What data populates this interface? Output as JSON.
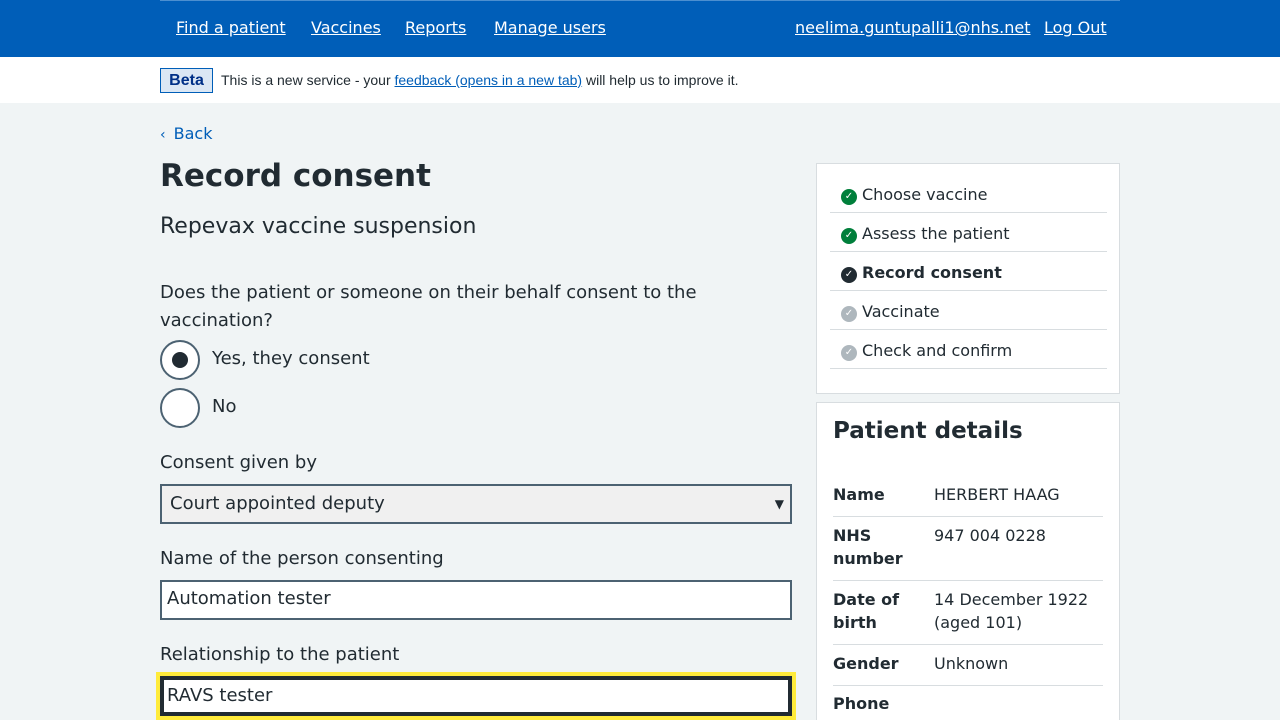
{
  "header": {
    "nav": [
      "Find a patient",
      "Vaccines",
      "Reports",
      "Manage users"
    ],
    "user_email": "neelima.guntupalli1@nhs.net",
    "logout": "Log Out"
  },
  "beta": {
    "tag": "Beta",
    "text_before": "This is a new service - your ",
    "link": "feedback (opens in a new tab)",
    "text_after": " will help us to improve it."
  },
  "back": "Back",
  "title": "Record consent",
  "vaccine": "Repevax vaccine suspension",
  "form": {
    "question": "Does the patient or someone on their behalf consent to the vaccination?",
    "options": [
      {
        "label": "Yes, they consent",
        "selected": true
      },
      {
        "label": "No",
        "selected": false
      }
    ],
    "consent_given_by": {
      "label": "Consent given by",
      "value": "Court appointed deputy"
    },
    "person_name": {
      "label": "Name of the person consenting",
      "value": "Automation tester"
    },
    "relationship": {
      "label": "Relationship to the patient",
      "value": "RAVS tester"
    }
  },
  "steps": [
    {
      "label": "Choose vaccine",
      "state": "done"
    },
    {
      "label": "Assess the patient",
      "state": "done"
    },
    {
      "label": "Record consent",
      "state": "current"
    },
    {
      "label": "Vaccinate",
      "state": "todo"
    },
    {
      "label": "Check and confirm",
      "state": "todo"
    }
  ],
  "patient": {
    "title": "Patient details",
    "rows": [
      {
        "key": "Name",
        "value": "HERBERT HAAG"
      },
      {
        "key": "NHS number",
        "value": "947 004 0228"
      },
      {
        "key": "Date of birth",
        "value": "14 December 1922 (aged 101)"
      },
      {
        "key": "Gender",
        "value": "Unknown"
      },
      {
        "key": "Phone number",
        "value": ""
      }
    ]
  },
  "colors": {
    "nhs_blue": "#005eb8",
    "text": "#212b32",
    "background": "#f0f4f5",
    "success": "#007f3b",
    "focus": "#ffeb3b"
  }
}
